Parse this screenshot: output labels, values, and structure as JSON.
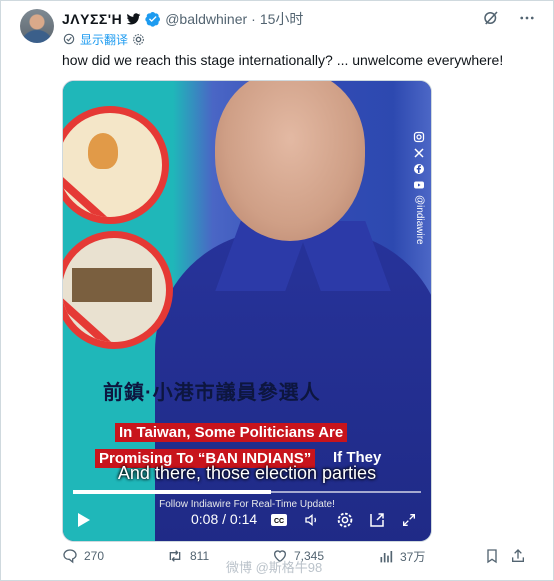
{
  "author": {
    "display_name": "JΛYΣΣ'H",
    "handle": "@baldwhiner",
    "dot": "·",
    "time": "15小时"
  },
  "translate_label": "显示翻译",
  "tweet_text": "how did we reach this stage internationally? ... unwelcome everywhere!",
  "video": {
    "sign_text": "前鎮·小港市議員參選人",
    "caption_line1": "In Taiwan, Some Politicians Are",
    "caption_line2": "Promising To “BAN INDIANS”",
    "caption_line2b": "If They",
    "subtitle": "And there, those election parties",
    "follow_text": "Follow Indiawire For Real-Time Update!",
    "time_display": "0:08 / 0:14",
    "progress": 0.57,
    "cc_label": "CC",
    "side_handle": "@indiawire"
  },
  "actions": {
    "replies": "270",
    "retweets": "811",
    "likes": "7,345",
    "views": "37万"
  },
  "watermark": "微博 @斯格牛98",
  "colors": {
    "accent": "#1d9bf0",
    "muted": "#536471",
    "caption_red": "#c8141c"
  }
}
